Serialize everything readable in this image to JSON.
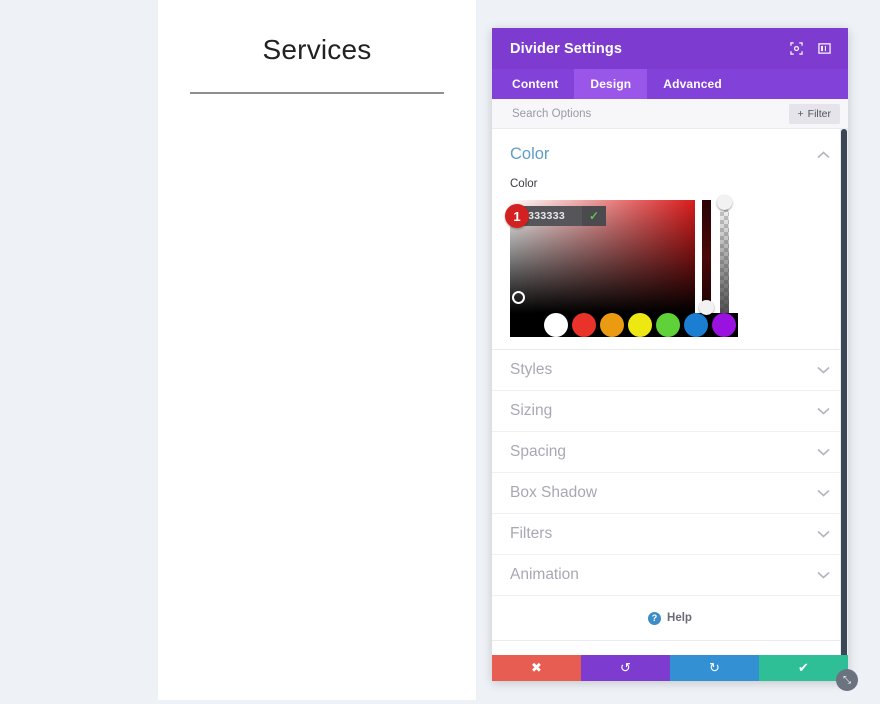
{
  "page": {
    "background_color": "#eef2f6",
    "content_background": "#ffffff",
    "heading": "Services",
    "divider_color": "#8f8f8f"
  },
  "modal": {
    "title": "Divider Settings",
    "header_color": "#7e3bd0",
    "header_icons": [
      {
        "name": "fullscreen-icon",
        "glyph": "⬚"
      },
      {
        "name": "layout-toggle-icon",
        "glyph": "▣"
      }
    ],
    "tabs": [
      {
        "label": "Content",
        "active": false
      },
      {
        "label": "Design",
        "active": true
      },
      {
        "label": "Advanced",
        "active": false
      }
    ],
    "search": {
      "placeholder": "Search Options",
      "value": ""
    },
    "filter_button": {
      "label": "Filter",
      "plus_glyph": "+"
    },
    "color_section": {
      "title": "Color",
      "expanded": true,
      "collapse_chevron": "⌃",
      "field_label": "Color",
      "hex_value": "#333333",
      "confirm_glyph": "✓",
      "step_badge": "1",
      "swatches": [
        {
          "name": "swatch-black",
          "color": "#000000"
        },
        {
          "name": "swatch-white",
          "color": "#ffffff"
        },
        {
          "name": "swatch-red",
          "color": "#e8322a"
        },
        {
          "name": "swatch-orange",
          "color": "#eb9b12"
        },
        {
          "name": "swatch-yellow",
          "color": "#eee812"
        },
        {
          "name": "swatch-green",
          "color": "#5fd139"
        },
        {
          "name": "swatch-blue",
          "color": "#1b7ed0"
        },
        {
          "name": "swatch-purple",
          "color": "#9a12e0"
        }
      ]
    },
    "collapsed_sections": [
      {
        "label": "Styles",
        "chevron": "⌄"
      },
      {
        "label": "Sizing",
        "chevron": "⌄"
      },
      {
        "label": "Spacing",
        "chevron": "⌄"
      },
      {
        "label": "Box Shadow",
        "chevron": "⌄"
      },
      {
        "label": "Filters",
        "chevron": "⌄"
      },
      {
        "label": "Animation",
        "chevron": "⌄"
      }
    ],
    "help": {
      "label": "Help",
      "icon_glyph": "?"
    },
    "footer_actions": [
      {
        "name": "cancel-button",
        "glyph": "✖",
        "color": "#e85d52"
      },
      {
        "name": "undo-button",
        "glyph": "↺",
        "color": "#7e3bd0"
      },
      {
        "name": "redo-button",
        "glyph": "↻",
        "color": "#3290d3"
      },
      {
        "name": "save-button",
        "glyph": "✔",
        "color": "#2fbf97"
      }
    ],
    "resize_handle_glyph": "⤡"
  }
}
